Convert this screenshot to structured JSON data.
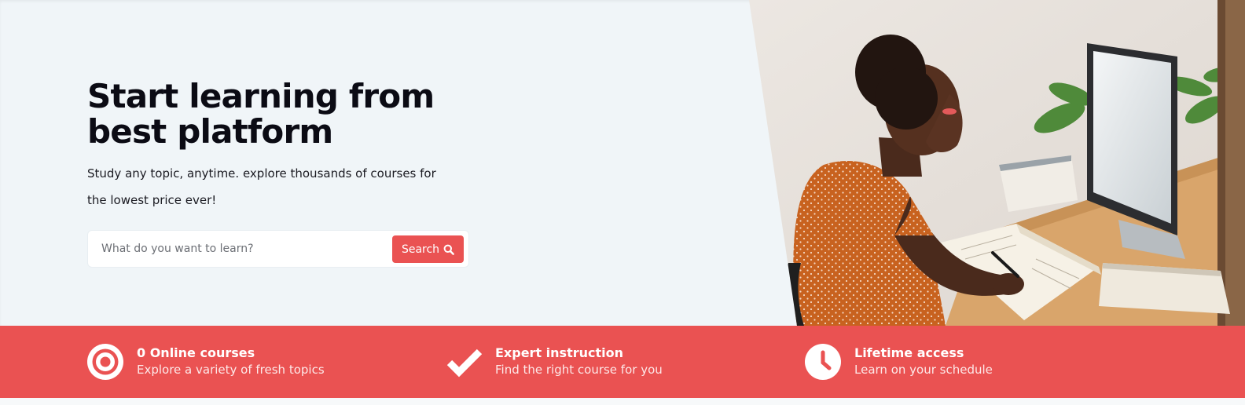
{
  "hero": {
    "title": "Start learning from best platform",
    "subtitle": "Study any topic, anytime. explore thousands of courses for the lowest price ever!",
    "background_color": "#f0f5f8",
    "image_description": "student-at-desk-photo"
  },
  "search": {
    "placeholder": "What do you want to learn?",
    "value": "",
    "button_label": "Search",
    "button_icon": "search-icon",
    "button_color": "#ea5252"
  },
  "features": {
    "background_color": "#ea5252",
    "items": [
      {
        "icon": "target-icon",
        "title": "0 Online courses",
        "description": "Explore a variety of fresh topics"
      },
      {
        "icon": "checkmark-icon",
        "title": "Expert instruction",
        "description": "Find the right course for you"
      },
      {
        "icon": "clock-icon",
        "title": "Lifetime access",
        "description": "Learn on your schedule"
      }
    ]
  }
}
